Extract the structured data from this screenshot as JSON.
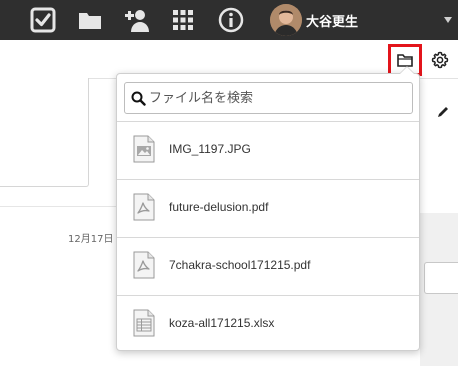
{
  "topbar": {
    "icons": [
      {
        "name": "check-square-icon"
      },
      {
        "name": "folder-icon"
      },
      {
        "name": "add-user-icon"
      },
      {
        "name": "apps-grid-icon"
      },
      {
        "name": "info-icon"
      }
    ],
    "user": {
      "name": "大谷更生",
      "avatar": "avatar-photo"
    }
  },
  "background": {
    "date_text": "12月17日"
  },
  "toolbar": {
    "folder_button_icon": "folder-open-icon",
    "settings_icon": "gear-icon",
    "highlight_color": "#e3141b"
  },
  "file_dropdown": {
    "search": {
      "placeholder": "ファイル名を検索",
      "value": ""
    },
    "files": [
      {
        "name": "IMG_1197.JPG",
        "type": "image",
        "icon": "image-file-icon"
      },
      {
        "name": "future-delusion.pdf",
        "type": "pdf",
        "icon": "pdf-file-icon"
      },
      {
        "name": "7chakra-school171215.pdf",
        "type": "pdf",
        "icon": "pdf-file-icon"
      },
      {
        "name": "koza-all171215.xlsx",
        "type": "spreadsheet",
        "icon": "spreadsheet-file-icon"
      }
    ]
  },
  "colors": {
    "topbar_bg": "#2f2f2f",
    "icon_color": "#e6e6e6"
  }
}
